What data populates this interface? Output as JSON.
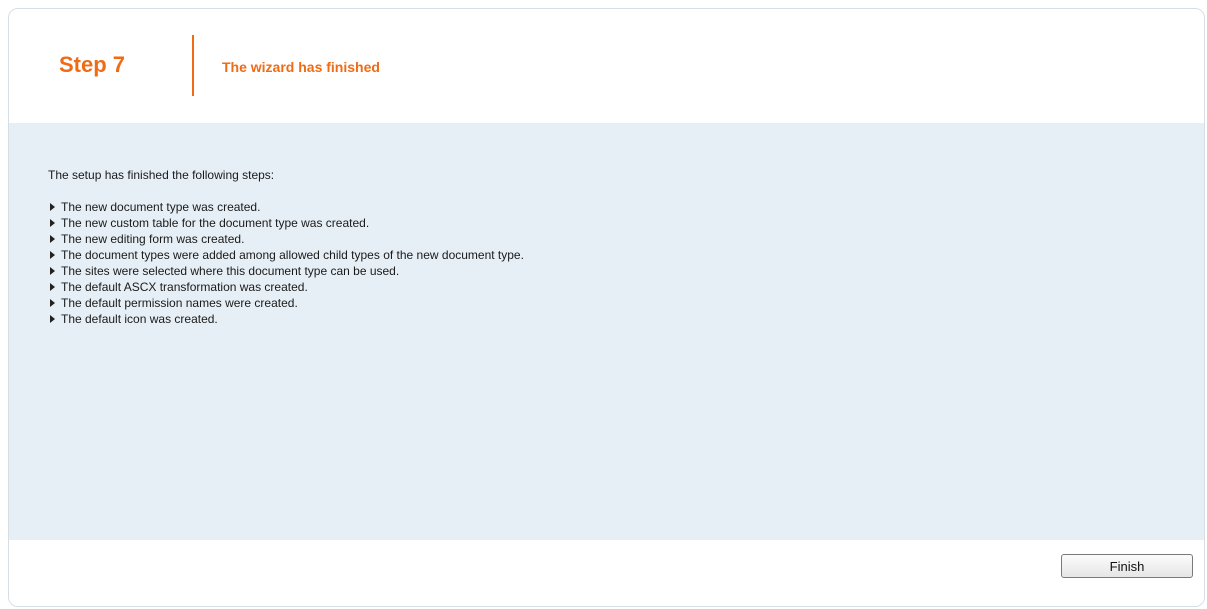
{
  "header": {
    "step_label": "Step 7",
    "title": "The wizard has finished"
  },
  "content": {
    "intro": "The setup has finished the following steps:",
    "steps": [
      "The new document type was created.",
      "The new custom table for the document type was created.",
      "The new editing form was created.",
      "The document types were added among allowed child types of the new document type.",
      "The sites were selected where this document type can be used.",
      "The default ASCX transformation was created.",
      "The default permission names were created.",
      "The default icon was created."
    ]
  },
  "footer": {
    "finish_label": "Finish"
  },
  "colors": {
    "accent": "#ef6b16",
    "content_background": "#e6eff6"
  }
}
